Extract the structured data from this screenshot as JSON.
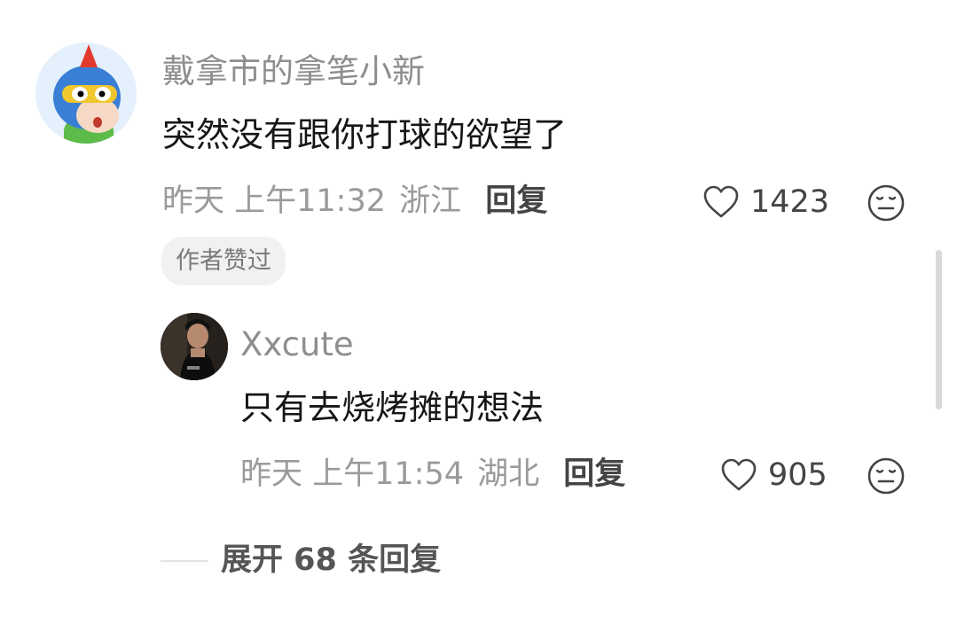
{
  "comment": {
    "username": "戴拿市的拿笔小新",
    "text": "突然没有跟你打球的欲望了",
    "time": "昨天 上午11:32",
    "location": "浙江",
    "reply_label": "回复",
    "like_count": "1423",
    "author_badge": "作者赞过"
  },
  "reply": {
    "username": "Xxcute",
    "text": "只有去烧烤摊的想法",
    "time": "昨天 上午11:54",
    "location": "湖北",
    "reply_label": "回复",
    "like_count": "905"
  },
  "expand": {
    "label": "展开 68 条回复"
  },
  "icons": {
    "like": "heart-outline-icon",
    "emoji": "neutral-face-icon"
  },
  "colors": {
    "text_primary": "#161616",
    "text_secondary": "#9a9a9a",
    "badge_bg": "#f1f1f1"
  }
}
